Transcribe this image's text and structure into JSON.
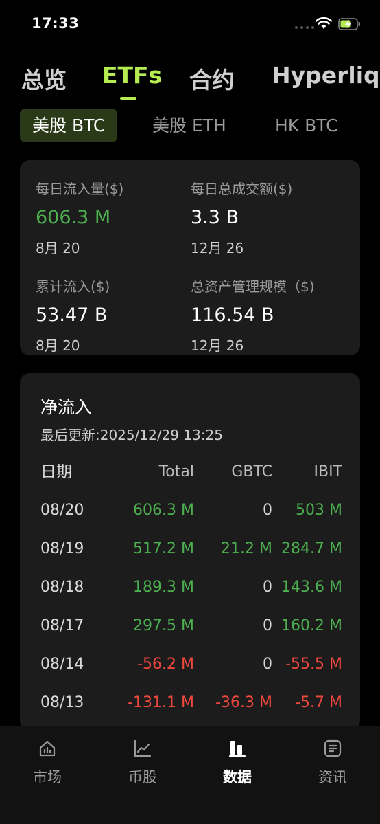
{
  "status_bar": {
    "time": "17:33"
  },
  "top_tabs": [
    {
      "label": "总览",
      "active": false
    },
    {
      "label": "ETFs",
      "active": true
    },
    {
      "label": "合约",
      "active": false
    },
    {
      "label": "Hyperliquid",
      "active": false
    }
  ],
  "sub_tabs": [
    {
      "label": "美股 BTC",
      "active": true
    },
    {
      "label": "美股 ETH",
      "active": false
    },
    {
      "label": "HK BTC",
      "active": false
    }
  ],
  "summary": {
    "daily_inflow": {
      "label": "每日流入量($)",
      "value": "606.3 M",
      "date": "8月 20"
    },
    "daily_volume": {
      "label": "每日总成交额($)",
      "value": "3.3 B",
      "date": "12月 26"
    },
    "cumulative_inflow": {
      "label": "累计流入($)",
      "value": "53.47 B",
      "date": "8月 20"
    },
    "aum": {
      "label": "总资产管理规模（$)",
      "value": "116.54 B",
      "date": "12月 26"
    }
  },
  "net_flow": {
    "title": "净流入",
    "updated": "最后更新:2025/12/29 13:25",
    "headers": {
      "date": "日期",
      "total": "Total",
      "gbtc": "GBTC",
      "ibit": "IBIT"
    },
    "rows": [
      {
        "date": "08/20",
        "total": "606.3 M",
        "gbtc": "0",
        "ibit": "503 M"
      },
      {
        "date": "08/19",
        "total": "517.2 M",
        "gbtc": "21.2 M",
        "ibit": "284.7 M"
      },
      {
        "date": "08/18",
        "total": "189.3 M",
        "gbtc": "0",
        "ibit": "143.6 M"
      },
      {
        "date": "08/17",
        "total": "297.5 M",
        "gbtc": "0",
        "ibit": "160.2 M"
      },
      {
        "date": "08/14",
        "total": "-56.2 M",
        "gbtc": "0",
        "ibit": "-55.5 M"
      },
      {
        "date": "08/13",
        "total": "-131.1 M",
        "gbtc": "-36.3 M",
        "ibit": "-5.7 M"
      }
    ]
  },
  "bottom_nav": [
    {
      "label": "市场",
      "icon": "market-icon",
      "active": false
    },
    {
      "label": "币股",
      "icon": "line-chart-icon",
      "active": false
    },
    {
      "label": "数据",
      "icon": "bar-chart-icon",
      "active": true
    },
    {
      "label": "资讯",
      "icon": "news-icon",
      "active": false
    }
  ],
  "colors": {
    "accent": "#b4ec51",
    "positive": "#4caf50",
    "negative": "#f0483e",
    "card": "#1c1c1c"
  }
}
